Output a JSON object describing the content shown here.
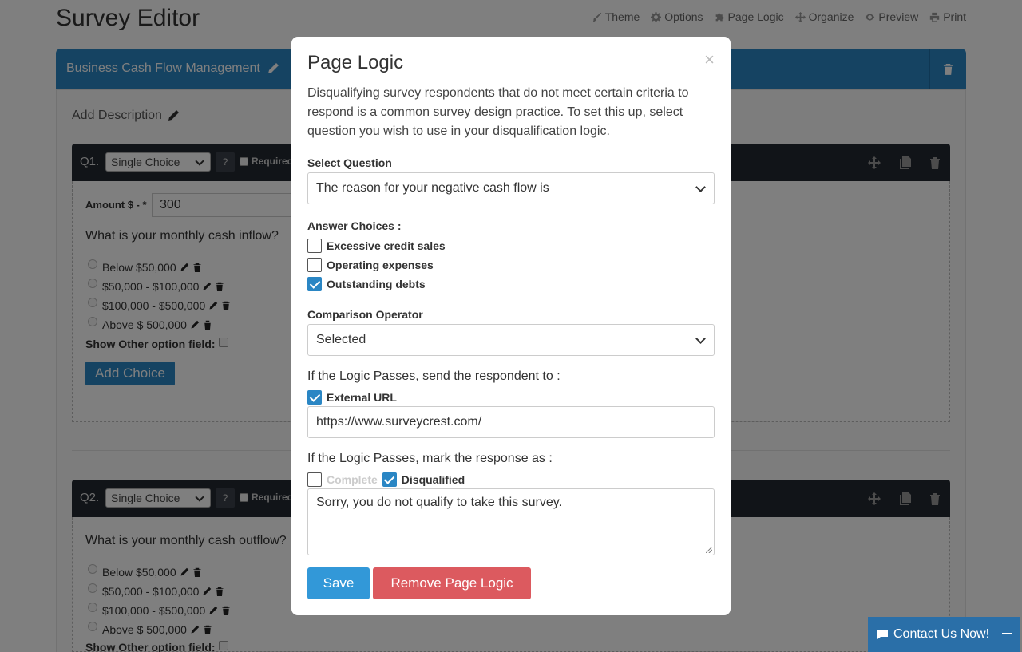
{
  "page_title": "Survey Editor",
  "topnav": [
    {
      "label": "Theme",
      "icon": "brush-icon"
    },
    {
      "label": "Options",
      "icon": "gear-icon"
    },
    {
      "label": "Page Logic",
      "icon": "puzzle-icon"
    },
    {
      "label": "Organize",
      "icon": "move-icon"
    },
    {
      "label": "Preview",
      "icon": "eye-icon"
    },
    {
      "label": "Print",
      "icon": "print-icon"
    }
  ],
  "survey": {
    "title": "Business Cash Flow Management",
    "add_description": "Add Description",
    "accent_color": "#2a86c4"
  },
  "q1": {
    "number": "Q1.",
    "type": "Single Choice",
    "help": "?",
    "required_label": "Required",
    "amount_label": "Amount $ - *",
    "amount_value": "300",
    "question": "What is your monthly cash inflow?",
    "options": [
      "Below $50,000",
      "$50,000 - $100,000",
      "$100,000 - $500,000",
      "Above $ 500,000"
    ],
    "other_label": "Show Other option field:",
    "add_choice": "Add Choice"
  },
  "q2": {
    "number": "Q2.",
    "type": "Single Choice",
    "help": "?",
    "required_label": "Required",
    "question": "What is your monthly cash outflow?",
    "options": [
      "Below $50,000",
      "$50,000 - $100,000",
      "$100,000 - $500,000",
      "Above $ 500,000"
    ],
    "other_label": "Show Other option field:"
  },
  "modal": {
    "title": "Page Logic",
    "close": "×",
    "description": "Disqualifying survey respondents that do not meet certain criteria to respond is a common survey design practice. To set this up, select question you wish to use in your disqualification logic.",
    "select_question_label": "Select Question",
    "select_question_value": "The reason for your negative cash flow is",
    "answer_choices_label": "Answer Choices :",
    "answer_choices": [
      {
        "label": "Excessive credit sales",
        "checked": false
      },
      {
        "label": "Operating expenses",
        "checked": false
      },
      {
        "label": "Outstanding debts",
        "checked": true
      }
    ],
    "comparison_label": "Comparison Operator",
    "comparison_value": "Selected",
    "send_label": "If the Logic Passes, send the respondent to :",
    "external_url_label": "External URL",
    "external_url_checked": true,
    "url_value": "https://www.surveycrest.com/",
    "mark_label": "If the Logic Passes, mark the response as :",
    "complete_label": "Complete",
    "complete_checked": false,
    "disqualified_label": "Disqualified",
    "disqualified_checked": true,
    "message_value": "Sorry, you do not qualify to take this survey.",
    "save_label": "Save",
    "remove_label": "Remove Page Logic",
    "save_color": "#3298d8",
    "remove_color": "#dc5a5f"
  },
  "contact": {
    "label": "Contact Us Now!",
    "icon": "chat-icon"
  }
}
